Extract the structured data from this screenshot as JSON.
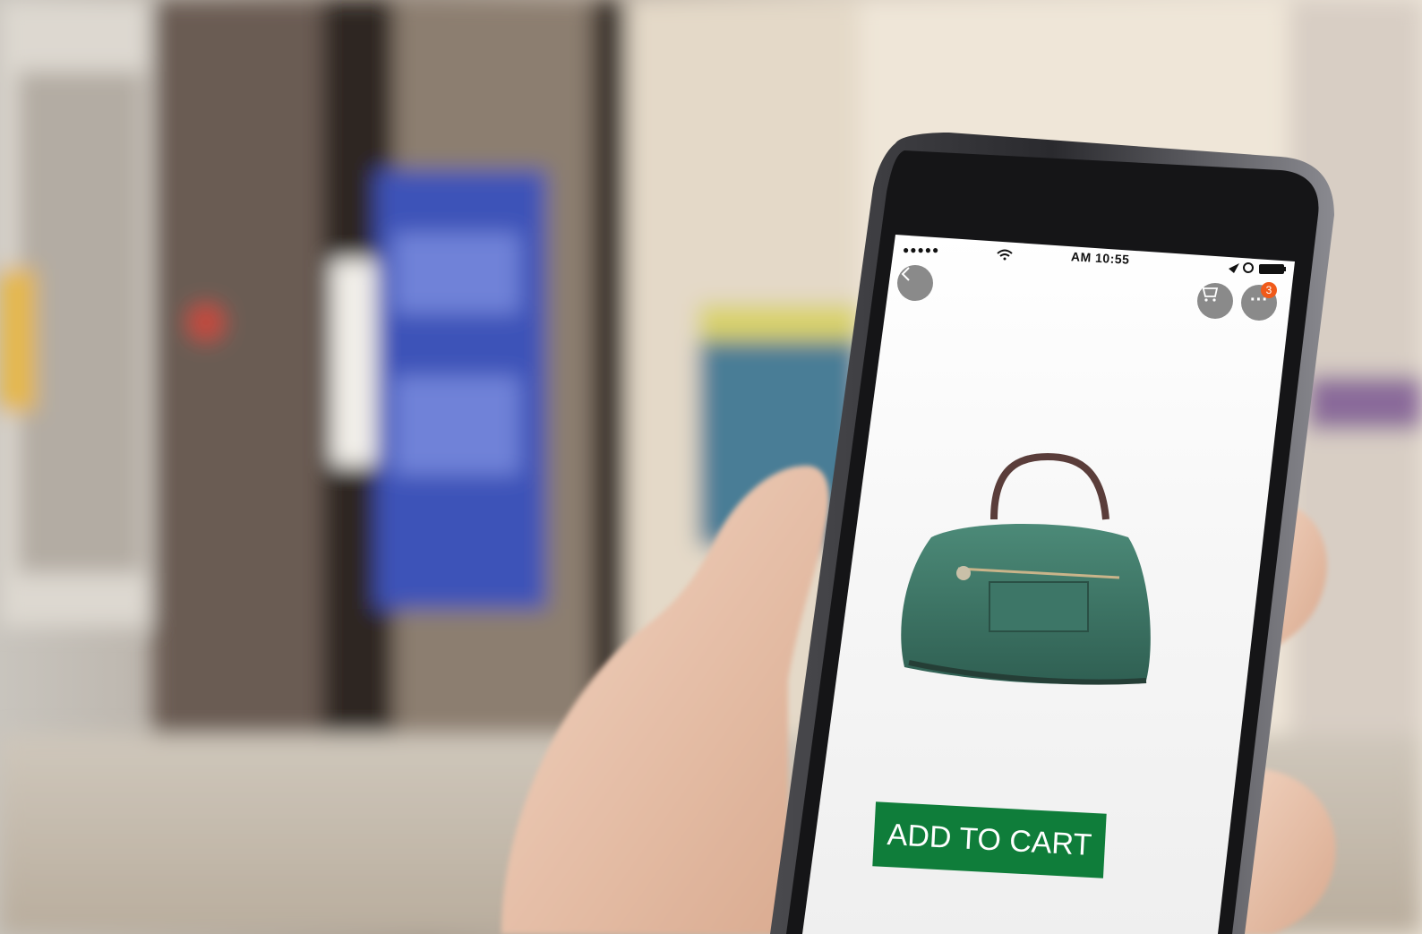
{
  "status_bar": {
    "signal": "●●●●●",
    "time": "AM 10:55"
  },
  "nav": {
    "back_icon": "chevron-left-icon",
    "cart_icon": "cart-icon",
    "more_icon": "more-icon",
    "more_glyph": "···",
    "badge_count": "3"
  },
  "product": {
    "image": "green-leather-handbag"
  },
  "actions": {
    "add_to_cart_label": "ADD TO CART"
  },
  "colors": {
    "cta": "#0f7d3a",
    "badge": "#f05a1a",
    "nav_button": "#8a8a8a",
    "bag": "#3f7a6a"
  }
}
